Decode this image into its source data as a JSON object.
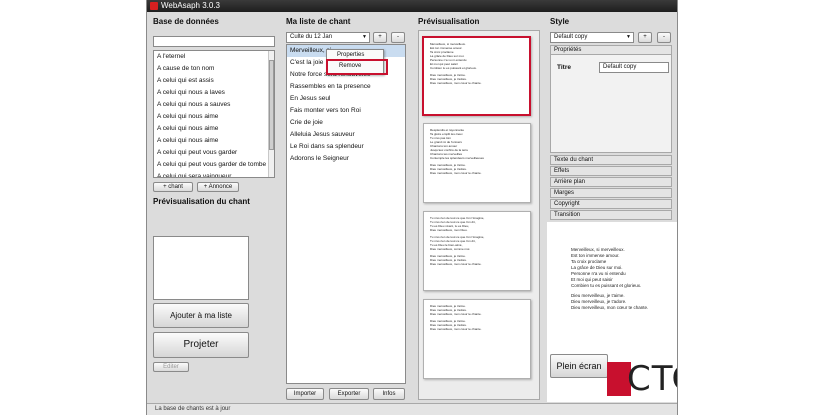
{
  "window": {
    "title": "WebAsaph 3.0.3"
  },
  "database": {
    "heading": "Base de données",
    "search_value": "",
    "songs": [
      "A l'eternel",
      "A cause de ton nom",
      "A celui qui est assis",
      "A celui qui nous a laves",
      "A celui qui nous a sauves",
      "A celui qui nous aime",
      "A celui qui nous aime",
      "A celui qui nous aime",
      "A celui qui peut vous garder",
      "A celui qui peut vous garder de tombe",
      "A celui qui sera vainqueur"
    ],
    "add_song_label": "+ chant",
    "add_announce_label": "+ Annonce"
  },
  "song_preview": {
    "heading": "Prévisualisation du chant"
  },
  "actions": {
    "add_to_list_label": "Ajouter à ma liste",
    "project_label": "Projeter",
    "edit_label": "Editer"
  },
  "my_list": {
    "heading": "Ma liste de chant",
    "selected_list": "Culte du 12 Jan",
    "plus_label": "+",
    "minus_label": "-",
    "songs": [
      "Merveilleux, si",
      "C'est la joie",
      "Notre force sera renouvelee",
      "Rassembles en ta presence",
      "En Jesus seul",
      "Fais monter vers ton Roi",
      "Crie de joie",
      "Alleluia Jesus sauveur",
      "Le Roi dans sa splendeur",
      "Adorons le Seigneur"
    ],
    "context_menu": [
      "Properties",
      "Remove"
    ],
    "import_label": "Importer",
    "export_label": "Exporter",
    "info_label": "Infos"
  },
  "preview": {
    "heading": "Prévisualisation",
    "slides": [
      {
        "lines": [
          "Merveilleux, si merveilleux.",
          "Est ton immense amour.",
          "Ta croix proclame",
          "La grâce de Dieu sur moi.",
          "Personne n'a vu ni entendu",
          "Et moi qui peut saisir",
          "Combien tu es puissant et glorieux.",
          "",
          "Dieu merveilleux, je t'aime.",
          "Dieu merveilleux, je t'adore.",
          "Dieu merveilleux, mon cœur te chante."
        ]
      },
      {
        "lines": [
          "Resplendis et rayonnante",
          "Ta gloire emplit les cieux",
          "Tu n'es pas loin",
          "Le grand roi de l'univers",
          "Chantons ton amour",
          "Jusqu'aux confins de la terre",
          "Chantons tes merveilles",
          "Contemple les splendeurs merveilleuses",
          "",
          "Dieu merveilleux, je t'aime.",
          "Dieu merveilleux, je t'adore.",
          "Dieu merveilleux, mon cœur te chante."
        ]
      },
      {
        "lines": [
          "Tu n'es rien de tout ce que l'on t'imagine,",
          "Tu n'es rien de tout ce que l'on dit,",
          "Tu es Dieu vivant, tu es Dieu,",
          "Dieu merveilleux, mon Dieu.",
          "",
          "Tu n'es rien de tout ce que l'on t'imagine,",
          "Tu n'es rien de tout ce que l'on dit,",
          "Tu es Dieu le bien-aimé,",
          "Dieu merveilleux, comme moi.",
          "",
          "Dieu merveilleux, je t'aime.",
          "Dieu merveilleux, je t'adore.",
          "Dieu merveilleux, mon cœur te chante."
        ]
      },
      {
        "lines": [
          "Dieu merveilleux, je t'aime.",
          "Dieu merveilleux, je t'adore.",
          "Dieu merveilleux, mon cœur te chante.",
          "",
          "Dieu merveilleux, je t'aime.",
          "Dieu merveilleux, je t'adore.",
          "Dieu merveilleux, mon cœur te chante."
        ]
      }
    ]
  },
  "style": {
    "heading": "Style",
    "selected_style": "Default copy",
    "plus_label": "+",
    "minus_label": "-",
    "properties_heading": "Propriétés",
    "title_label": "Titre",
    "title_value": "Default copy",
    "sections": [
      "Texte du chant",
      "Effets",
      "Arrière plan",
      "Marges",
      "Copyright",
      "Transition"
    ]
  },
  "output": {
    "lines": [
      "Merveilleux, si merveilleux.",
      "Est ton immense amour.",
      "Ta croix proclame",
      "La grâce de Dieu sur moi.",
      "Personne n'a vu ni entendu",
      "Et moi qui peut saisir",
      "Combien tu es puissant et glorieux.",
      "",
      "Dieu merveilleux, je t'aime.",
      "Dieu merveilleux, je t'adore.",
      "Dieu merveilleux, mon cœur te chante."
    ],
    "fullscreen_label": "Plein écran",
    "logo_text": "CTC"
  },
  "status": {
    "text": "La base de chants est à jour"
  },
  "colors": {
    "accent": "#c8102e",
    "selection": "#c9dcf0"
  }
}
